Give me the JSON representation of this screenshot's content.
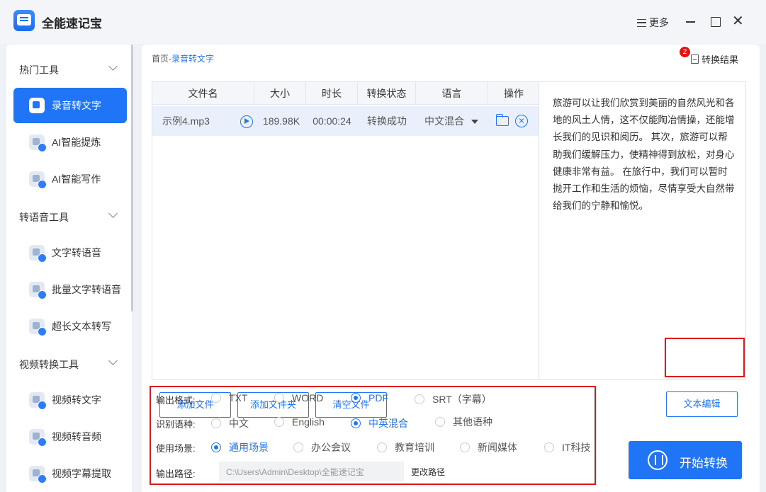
{
  "app": {
    "title": "全能速记宝",
    "more_label": "更多"
  },
  "sidebar": {
    "groups": [
      {
        "label": "热门工具"
      },
      {
        "label": "转语音工具"
      },
      {
        "label": "视频转换工具"
      }
    ],
    "items": [
      {
        "label": "录音转文字",
        "active": true
      },
      {
        "label": "AI智能提炼"
      },
      {
        "label": "AI智能写作"
      },
      {
        "label": "文字转语音"
      },
      {
        "label": "批量文字转语音"
      },
      {
        "label": "超长文本转写"
      },
      {
        "label": "视频转文字"
      },
      {
        "label": "视频转音频"
      },
      {
        "label": "视频字幕提取"
      }
    ]
  },
  "breadcrumb": {
    "home": "首页",
    "separator": "-",
    "current": "录音转文字"
  },
  "result": {
    "badge": "2",
    "label": "转换结果"
  },
  "table": {
    "headers": [
      "文件名",
      "大小",
      "时长",
      "转换状态",
      "语言",
      "操作"
    ],
    "rows": [
      {
        "name": "示例4.mp3",
        "size": "189.98K",
        "duration": "00:00:24",
        "status": "转换成功",
        "language": "中文混合"
      }
    ]
  },
  "buttons": {
    "add_file": "添加文件",
    "add_folder": "添加文件夹",
    "clear_files": "清空文件",
    "text_edit": "文本编辑",
    "start": "开始转换"
  },
  "preview": {
    "text": "旅游可以让我们欣赏到美丽的自然风光和各地的风土人情，这不仅能陶冶情操，还能增长我们的见识和阅历。 其次，旅游可以帮助我们缓解压力，使精神得到放松，对身心健康非常有益。 在旅行中，我们可以暂时抛开工作和生活的烦恼，尽情享受大自然带给我们的宁静和愉悦。"
  },
  "settings": {
    "format": {
      "label": "输出格式:",
      "options": [
        "TXT",
        "WORD",
        "PDF",
        "SRT（字幕）"
      ],
      "selected": "PDF"
    },
    "language": {
      "label": "识别语种:",
      "options": [
        "中文",
        "English",
        "中英混合",
        "其他语种"
      ],
      "selected": "中英混合"
    },
    "scene": {
      "label": "使用场景:",
      "options": [
        "通用场景",
        "办公会议",
        "教育培训",
        "新闻媒体",
        "IT科技"
      ],
      "selected": "通用场景"
    },
    "path": {
      "label": "输出路径:",
      "value": "C:\\Users\\Admin\\Desktop\\全能速记宝",
      "change_label": "更改路径"
    }
  }
}
